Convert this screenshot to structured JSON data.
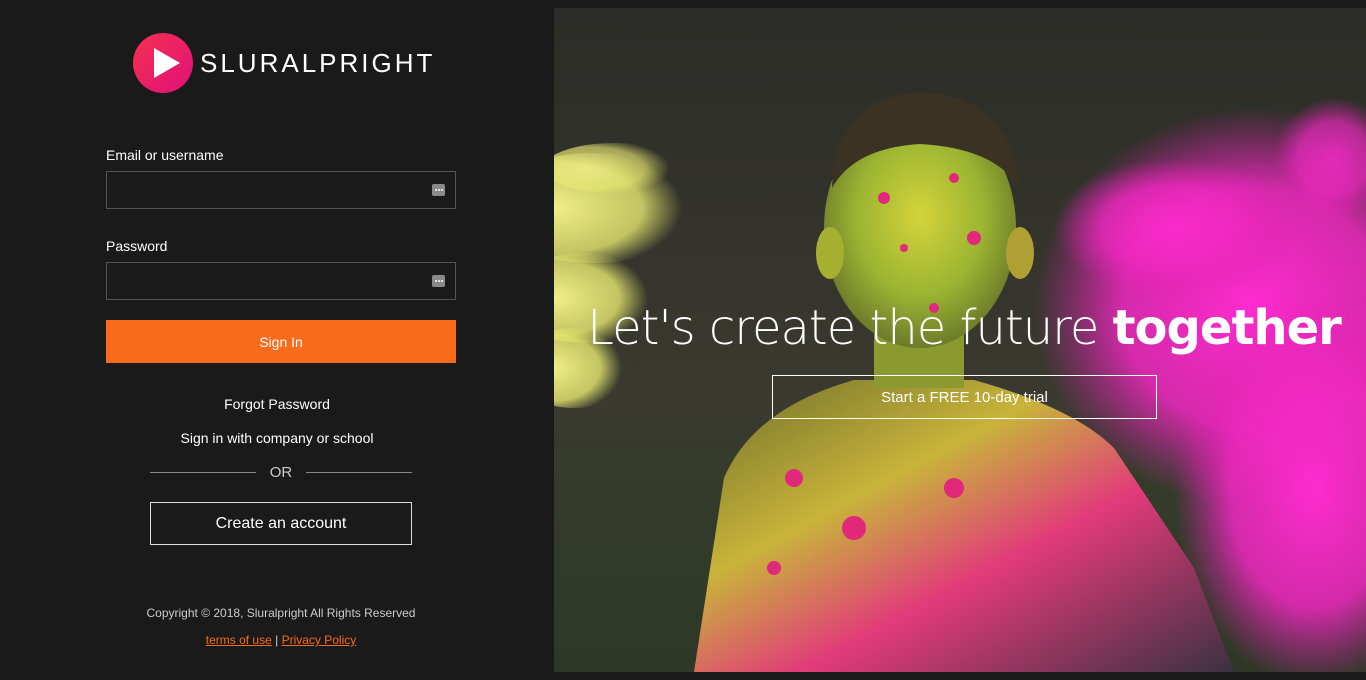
{
  "brand": {
    "name": "SLURALPRIGHT",
    "accent": "#f96b1c",
    "logo_icon": "play-icon"
  },
  "login": {
    "email_label": "Email or username",
    "email_value": "",
    "password_label": "Password",
    "password_value": "",
    "field_icon": "password-manager-icon",
    "signin_label": "Sign In",
    "forgot_label": "Forgot Password",
    "company_label": "Sign in with company or school",
    "or_label": "OR",
    "create_label": "Create an account"
  },
  "footer": {
    "copyright": "Copyright © 2018, Sluralpright All Rights Reserved",
    "terms": "terms of use",
    "separator": "|",
    "privacy": "Privacy Policy"
  },
  "hero": {
    "headline_light": "Let's create the future ",
    "headline_bold": "together",
    "trial_label": "Start a FREE 10-day trial"
  }
}
